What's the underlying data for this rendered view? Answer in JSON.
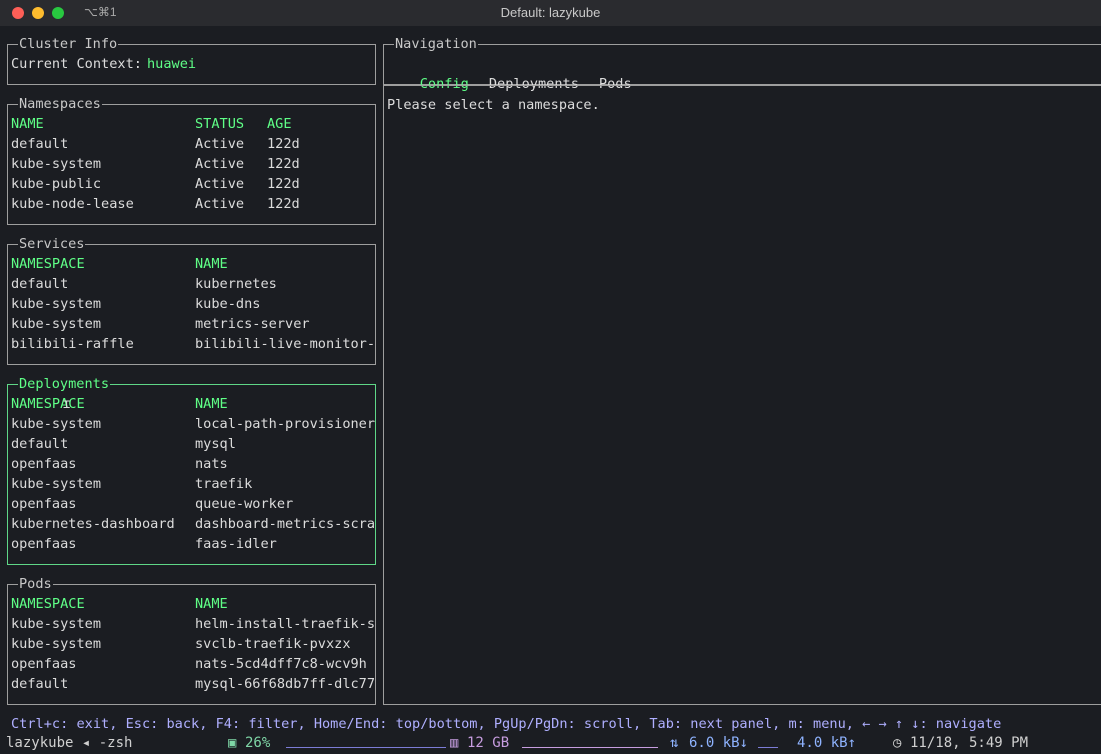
{
  "window": {
    "shortcut": "⌥⌘1",
    "title": "Default: lazykube"
  },
  "cluster_info": {
    "title": "Cluster Info",
    "label": "Current Context: ",
    "value": "huawei"
  },
  "namespaces": {
    "title": "Namespaces",
    "headers": [
      "NAME",
      "STATUS",
      "AGE"
    ],
    "rows": [
      [
        "default",
        "Active",
        "122d"
      ],
      [
        "kube-system",
        "Active",
        "122d"
      ],
      [
        "kube-public",
        "Active",
        "122d"
      ],
      [
        "kube-node-lease",
        "Active",
        "122d"
      ]
    ]
  },
  "services": {
    "title": "Services",
    "headers": [
      "NAMESPACE",
      "NAME"
    ],
    "rows": [
      [
        "default",
        "kubernetes"
      ],
      [
        "kube-system",
        "kube-dns"
      ],
      [
        "kube-system",
        "metrics-server"
      ],
      [
        "bilibili-raffle",
        "bilibili-live-monitor-"
      ]
    ]
  },
  "deployments": {
    "title": "Deployments",
    "headers": [
      "NAMESPACE",
      "NAME"
    ],
    "rows": [
      [
        "kube-system",
        "local-path-provisioner"
      ],
      [
        "default",
        "mysql"
      ],
      [
        "openfaas",
        "nats"
      ],
      [
        "kube-system",
        "traefik"
      ],
      [
        "openfaas",
        "queue-worker"
      ],
      [
        "kubernetes-dashboard",
        "dashboard-metrics-scra"
      ],
      [
        "openfaas",
        "faas-idler"
      ]
    ]
  },
  "pods": {
    "title": "Pods",
    "headers": [
      "NAMESPACE",
      "NAME"
    ],
    "rows": [
      [
        "kube-system",
        "helm-install-traefik-s"
      ],
      [
        "kube-system",
        "svclb-traefik-pvxzx"
      ],
      [
        "openfaas",
        "nats-5cd4dff7c8-wcv9h"
      ],
      [
        "default",
        "mysql-66f68db7ff-dlc77"
      ]
    ]
  },
  "navigation": {
    "title": "Navigation",
    "tabs": [
      "Config",
      "Deployments",
      "Pods"
    ],
    "active_tab": "Config",
    "message": "Please select a namespace."
  },
  "help": "Ctrl+c: exit, Esc: back, F4: filter, Home/End: top/bottom, PgUp/PgDn: scroll, Tab: next panel, m: menu, ← → ↑ ↓: navigate",
  "status_bar": {
    "session": "lazykube ◂ -zsh",
    "cpu": "26%",
    "mem": "12 GB",
    "net_down": "6.0 kB↓",
    "net_up": "4.0 kB↑",
    "clock": "11/18, 5:49 PM"
  },
  "colors": {
    "accent": "#5fff87",
    "active_border": "#5fd787",
    "help_text": "#afafff"
  }
}
